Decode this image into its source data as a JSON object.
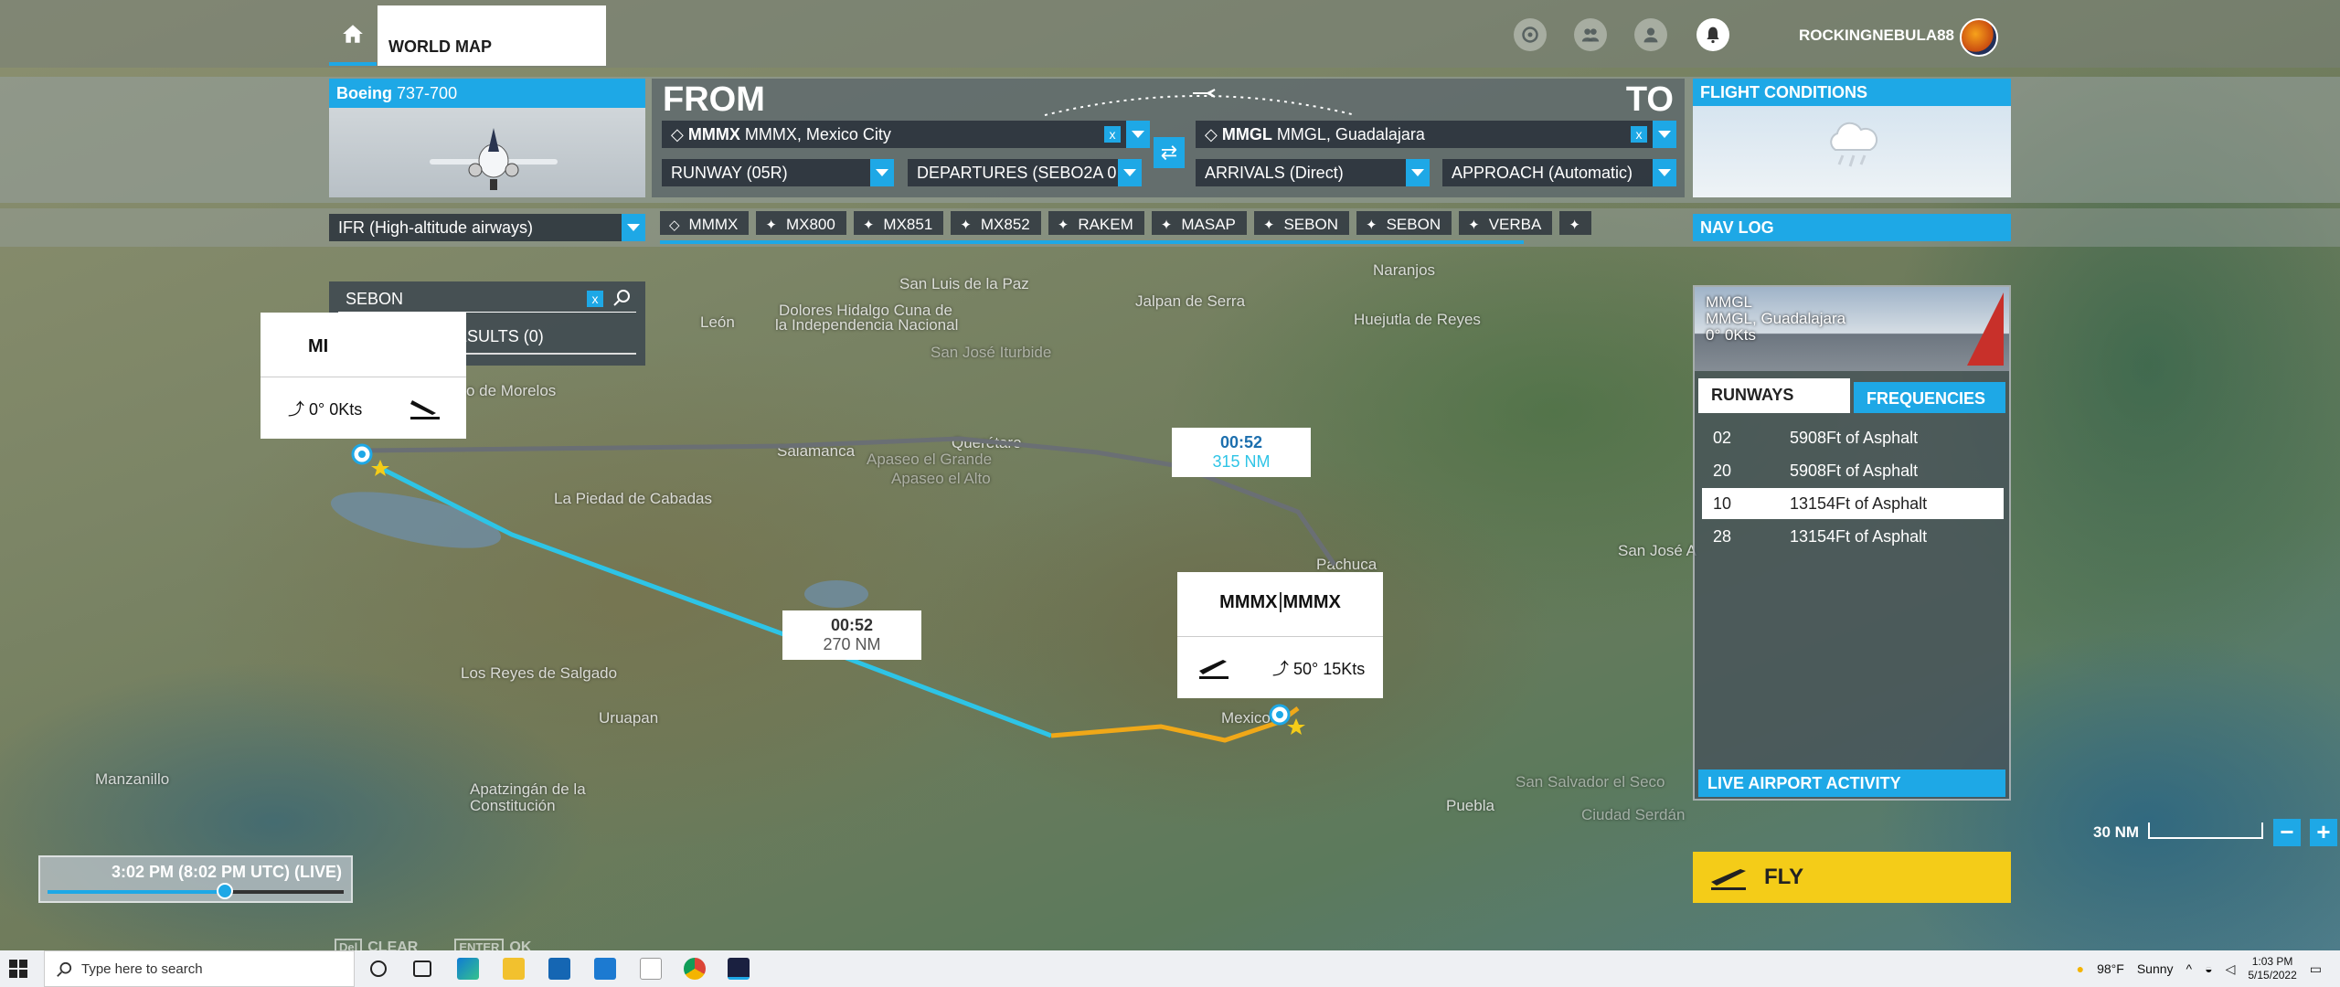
{
  "top_bar": {
    "world_map_label": "WORLD MAP",
    "username": "ROCKINGNEBULA88"
  },
  "aircraft": {
    "make": "Boeing",
    "model": "737-700"
  },
  "route": {
    "from_label": "FROM",
    "to_label": "TO",
    "departure_code": "MMMX",
    "departure_name": "MMMX, Mexico City",
    "arrival_code": "MMGL",
    "arrival_name": "MMGL, Guadalajara",
    "runway": "RUNWAY (05R)",
    "departures": "DEPARTURES (SEBO2A 0",
    "arrivals": "ARRIVALS (Direct)",
    "approach": "APPROACH (Automatic)",
    "clear_symbol": "x"
  },
  "flight_conditions": {
    "title": "FLIGHT CONDITIONS"
  },
  "flight_type": "IFR (High-altitude airways)",
  "waypoints": [
    "MMMX",
    "MX800",
    "MX851",
    "MX852",
    "RAKEM",
    "MASAP",
    "SEBON",
    "SEBON",
    "VERBA"
  ],
  "nav_log_title": "NAV LOG",
  "search": {
    "query": "SEBON",
    "results_label": "SEARCH RESULTS (0)",
    "clear_symbol": "x"
  },
  "origin_card": {
    "code": "MI",
    "wind": "0° 0Kts"
  },
  "destination_card": {
    "code": "MMMX",
    "code_repeat": "MMMX",
    "wind": "50° 15Kts"
  },
  "legs": [
    {
      "time": "00:52",
      "distance": "315 NM"
    },
    {
      "time": "00:52",
      "distance": "270 NM"
    }
  ],
  "airport_panel": {
    "code": "MMGL",
    "name": "MMGL, Guadalajara",
    "wind": "0° 0Kts",
    "tab_runways": "RUNWAYS",
    "tab_frequencies": "FREQUENCIES",
    "runways": [
      {
        "id": "02",
        "info": "5908Ft of Asphalt"
      },
      {
        "id": "20",
        "info": "5908Ft of Asphalt"
      },
      {
        "id": "10",
        "info": "13154Ft of Asphalt"
      },
      {
        "id": "28",
        "info": "13154Ft of Asphalt"
      }
    ],
    "live_activity": "LIVE AIRPORT ACTIVITY"
  },
  "fly_label": "FLY",
  "scale": {
    "label": "30 NM",
    "zoom_out": "−",
    "zoom_in": "+"
  },
  "time": {
    "label": "3:02 PM (8:02 PM UTC) (LIVE)",
    "progress": 0.6
  },
  "hints": {
    "clear_key": "Del",
    "clear": "CLEAR",
    "ok_key": "ENTER",
    "ok": "OK"
  },
  "map_labels": {
    "naranjos": "Naranjos",
    "san_luis": "San Luis de la Paz",
    "dolores": "Dolores Hidalgo Cuna de",
    "dolores2": "la Independencia Nacional",
    "leon": "León",
    "jalpan": "Jalpan de Serra",
    "huejutla": "Huejutla de Reyes",
    "san_jose": "San José Iturbide",
    "morelos": "o de Morelos",
    "salamanca": "Salamanca",
    "queretaro": "Querétaro",
    "apaseo1": "Apaseo el Grande",
    "apaseo2": "Apaseo el Alto",
    "piedad": "La Piedad de Cabadas",
    "pachuca": "Pachuca",
    "san_jose_a": "San José A",
    "reyes": "Los Reyes de Salgado",
    "uruapan": "Uruapan",
    "mexico": "Mexico",
    "manzanillo": "Manzanillo",
    "apatzingan1": "Apatzingán de la",
    "apatzingan2": "Constitución",
    "puebla": "Puebla",
    "salvador": "San Salvador el Seco",
    "serdan": "Ciudad Serdán"
  },
  "taskbar": {
    "search_placeholder": "Type here to search",
    "temperature": "98°F",
    "weather": "Sunny",
    "time": "1:03 PM",
    "date": "5/15/2022"
  },
  "colors": {
    "accent": "#1ea8e6",
    "route_flown": "#2ec4e6",
    "route_planned": "#f0a818",
    "fly": "#f4cc18"
  }
}
